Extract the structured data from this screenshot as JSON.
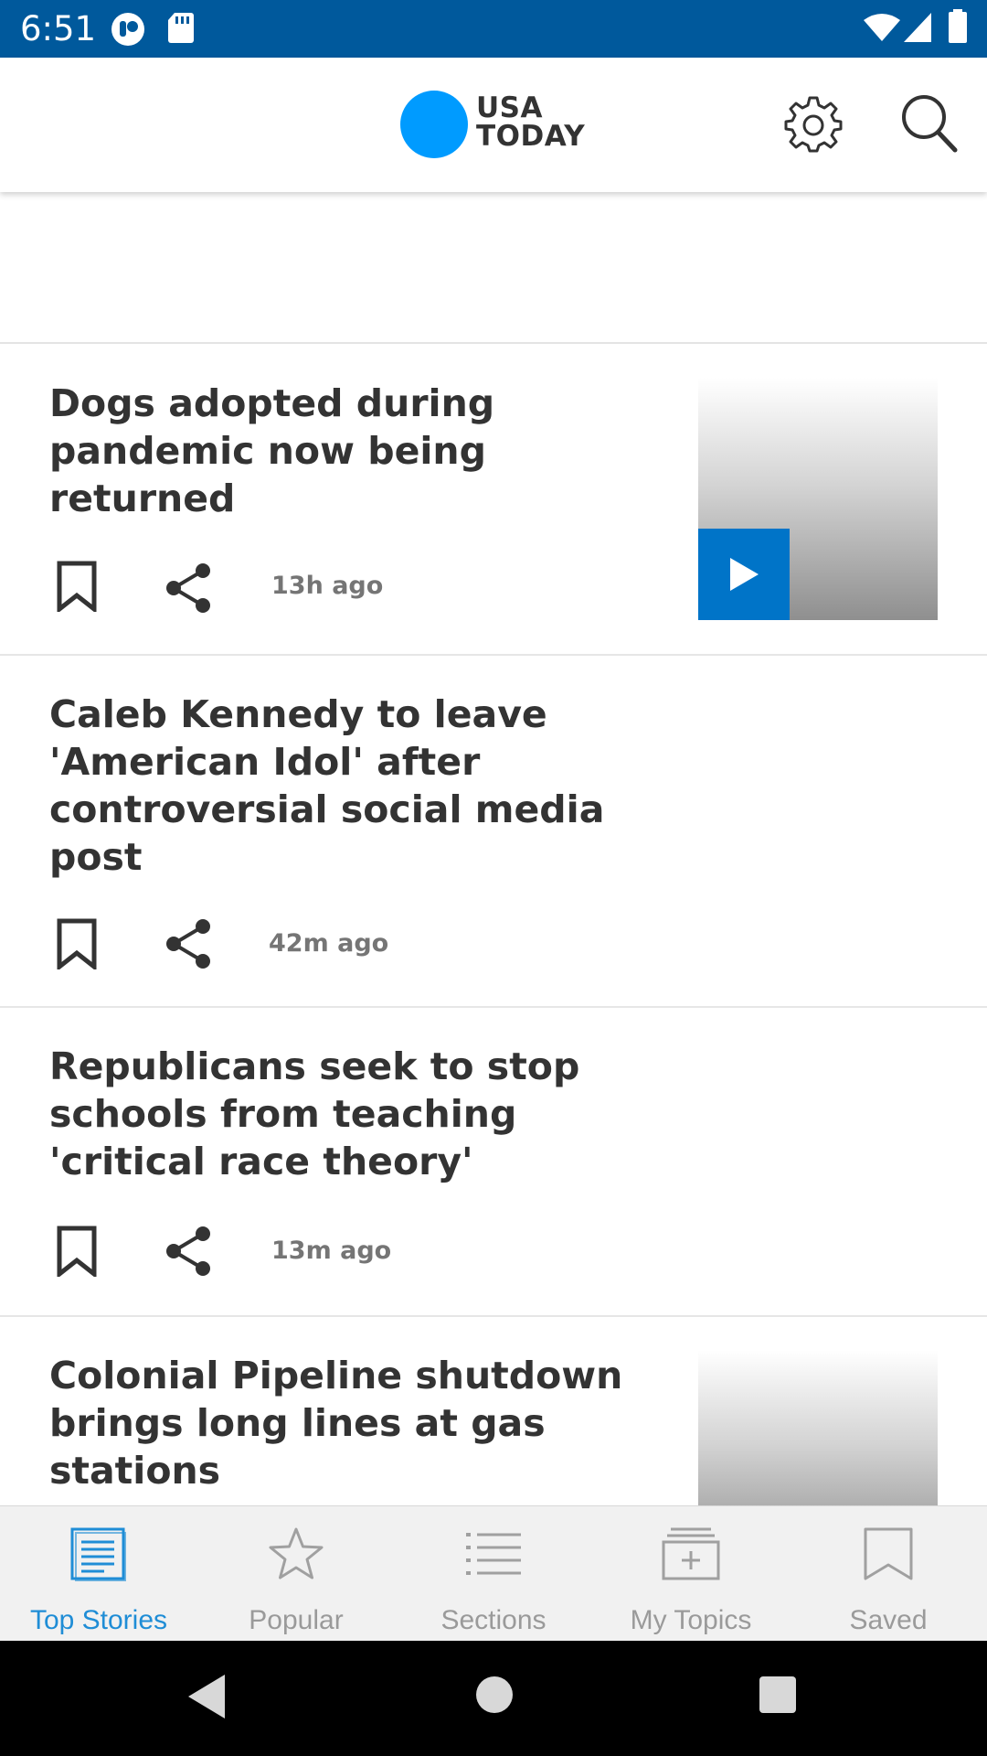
{
  "status_bar": {
    "time": "6:51",
    "left_icons": [
      "notification-app-icon",
      "sd-card-icon"
    ],
    "right_icons": [
      "wifi-icon",
      "cell-signal-icon",
      "battery-icon"
    ],
    "background_color": "#00599c"
  },
  "header": {
    "logo_line1": "USA",
    "logo_line2": "TODAY",
    "logo_color": "#009bff",
    "settings_icon": "gear-icon",
    "search_icon": "search-icon"
  },
  "stories": [
    {
      "title": "Dogs adopted during pandemic now being returned",
      "title_lines": [
        "Dogs adopted during",
        "pandemic now being",
        "returned"
      ],
      "time": "13h ago",
      "has_thumbnail": true,
      "has_video": true
    },
    {
      "title": "Caleb Kennedy to leave 'American Idol' after controversial social media post",
      "title_lines": [
        "Caleb Kennedy to leave",
        "'American Idol' after",
        "controversial social media",
        "post"
      ],
      "time": "42m ago",
      "has_thumbnail": false
    },
    {
      "title": "Republicans seek to stop schools from teaching 'critical race theory'",
      "title_lines": [
        "Republicans seek to stop",
        "schools from teaching",
        "'critical race theory'"
      ],
      "time": "13m ago",
      "has_thumbnail": false
    },
    {
      "title": "Colonial Pipeline shutdown brings long lines at gas stations",
      "title_lines": [
        "Colonial Pipeline shutdown",
        "brings long lines at gas",
        "stations"
      ],
      "has_thumbnail": true,
      "has_video": true
    }
  ],
  "bottom_nav": {
    "items": [
      {
        "label": "Top Stories",
        "icon": "newspaper-icon",
        "active": true
      },
      {
        "label": "Popular",
        "icon": "star-icon",
        "active": false
      },
      {
        "label": "Sections",
        "icon": "list-icon",
        "active": false
      },
      {
        "label": "My Topics",
        "icon": "topics-folder-icon",
        "active": false
      },
      {
        "label": "Saved",
        "icon": "bookmark-icon",
        "active": false
      }
    ],
    "active_color": "#1f8dd6",
    "inactive_color": "#9a9a9a"
  },
  "android_nav": {
    "buttons": [
      "back-icon",
      "home-icon",
      "recents-icon"
    ]
  }
}
